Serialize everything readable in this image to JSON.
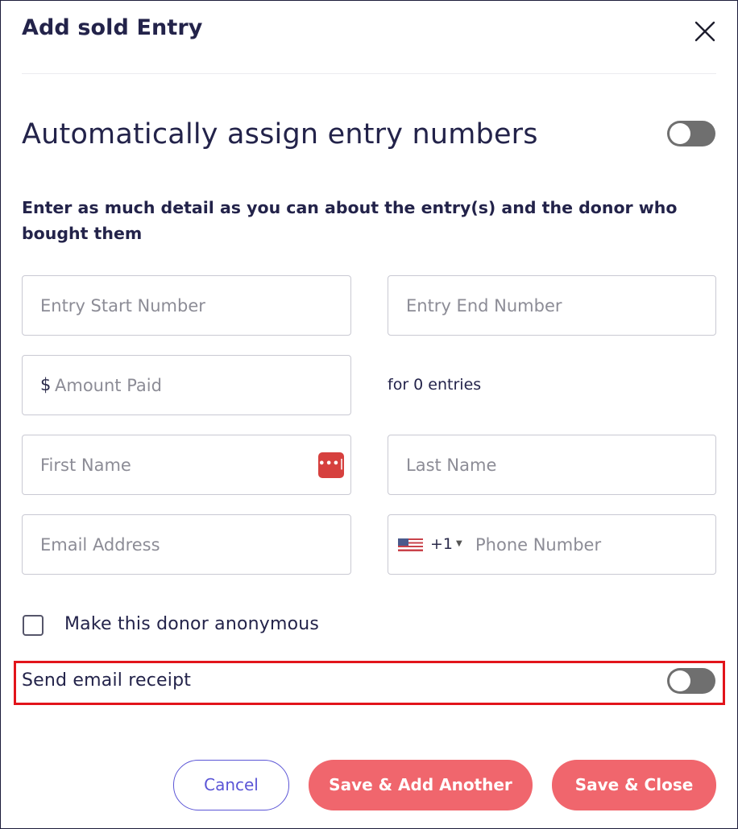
{
  "dialog": {
    "title": "Add sold Entry",
    "auto_assign_label": "Automatically assign entry numbers",
    "auto_assign_on": false,
    "instructions": "Enter as much detail as you can about the entry(s) and the donor who bought them"
  },
  "form": {
    "entry_start_placeholder": "Entry Start Number",
    "entry_end_placeholder": "Entry End Number",
    "currency_symbol": "$",
    "amount_placeholder": "Amount Paid",
    "entries_note": "for 0 entries",
    "first_name_placeholder": "First Name",
    "last_name_placeholder": "Last Name",
    "email_placeholder": "Email Address",
    "phone_country_code": "+1",
    "phone_placeholder": "Phone Number",
    "password_manager_icon_text": "•••|"
  },
  "options": {
    "anonymous_label": "Make this donor anonymous",
    "anonymous_checked": false,
    "send_receipt_label": "Send email receipt",
    "send_receipt_on": false
  },
  "buttons": {
    "cancel": "Cancel",
    "save_add_another": "Save & Add Another",
    "save_close": "Save & Close"
  },
  "colors": {
    "primary_button": "#f0666d",
    "cancel_outline": "#5b55d6",
    "highlight": "#e2141b",
    "toggle_off": "#6f6f6f"
  }
}
